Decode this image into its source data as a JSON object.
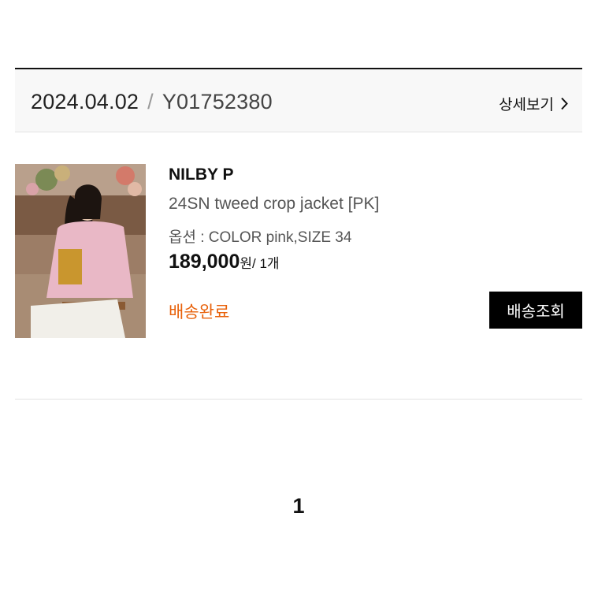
{
  "order": {
    "date": "2024.04.02",
    "separator": "/",
    "number": "Y01752380",
    "detail_label": "상세보기"
  },
  "item": {
    "brand": "NILBY P",
    "name": "24SN tweed crop jacket [PK]",
    "option": "옵션 : COLOR pink,SIZE 34",
    "price": "189,000",
    "price_unit": "원/ 1개",
    "status": "배송완료",
    "track_label": "배송조회",
    "status_color": "#e8610a"
  },
  "pagination": {
    "current": "1"
  }
}
